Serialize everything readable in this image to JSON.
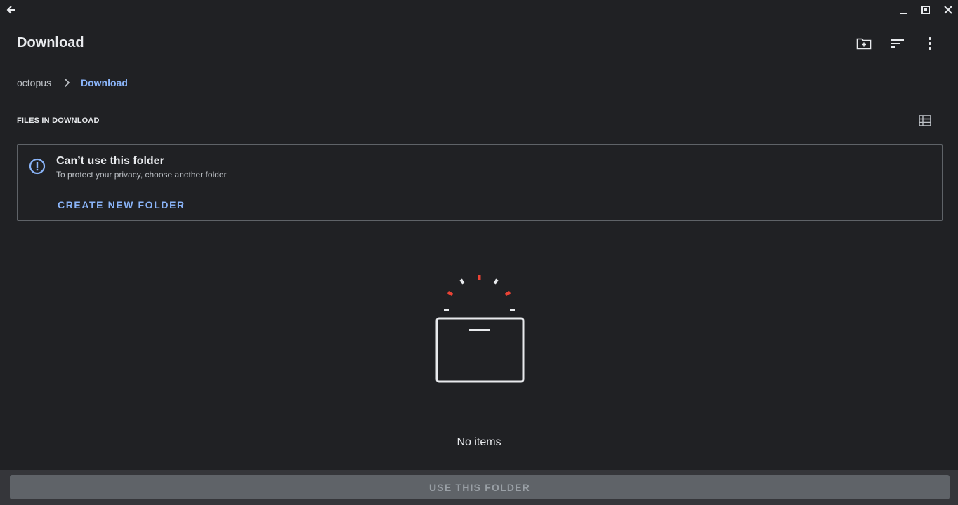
{
  "window": {
    "back_icon": "arrow-back-icon",
    "minimize_icon": "minimize-icon",
    "maximize_icon": "restore-icon",
    "close_icon": "close-icon"
  },
  "header": {
    "title": "Download",
    "actions": [
      "new-folder-icon",
      "sort-icon",
      "more-vert-icon"
    ]
  },
  "breadcrumb": {
    "items": [
      "octopus",
      "Download"
    ],
    "separator_icon": "chevron-right-icon"
  },
  "section": {
    "title": "FILES IN DOWNLOAD",
    "view_toggle_icon": "list-view-icon"
  },
  "warning": {
    "icon": "info-alert-icon",
    "title": "Can’t use this folder",
    "subtitle": "To protect your privacy, choose another folder",
    "action_label": "CREATE NEW FOLDER"
  },
  "empty_state": {
    "illustration": "empty-box-icon",
    "text": "No items"
  },
  "footer": {
    "use_folder_label": "USE THIS FOLDER"
  },
  "colors": {
    "background": "#202124",
    "accent": "#8ab4f8",
    "border": "#5f6368",
    "footer": "#35363a",
    "disabled_button": "#5f6368",
    "illustration_red": "#ea4335"
  }
}
